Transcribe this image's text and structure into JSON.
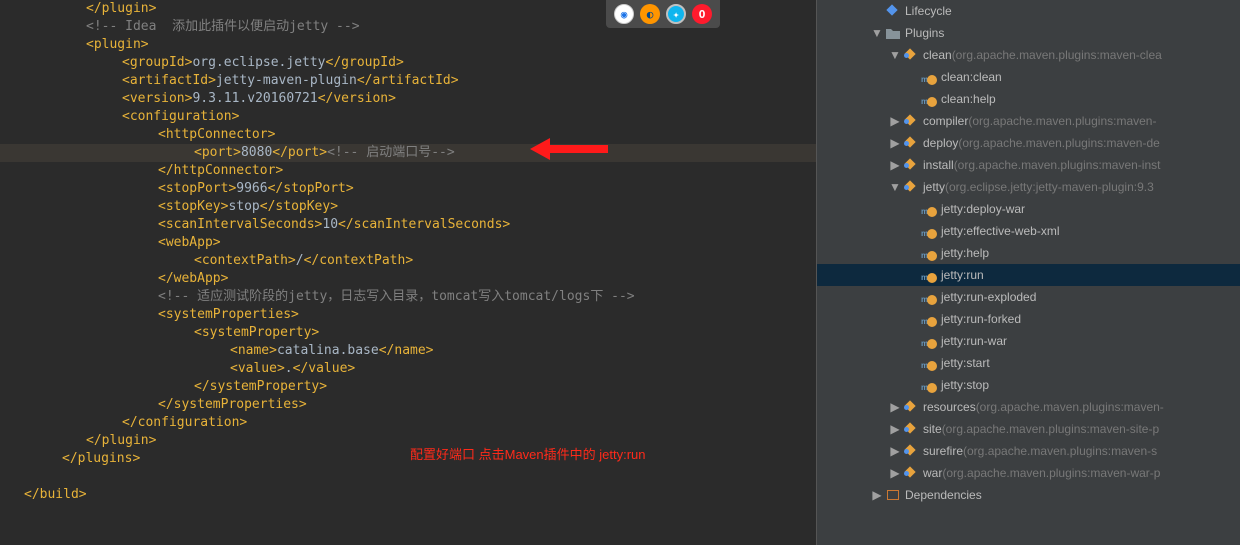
{
  "editor": {
    "lines": [
      {
        "indent": 86,
        "tokens": [
          {
            "c": "tag",
            "t": "</plugin>"
          }
        ]
      },
      {
        "indent": 86,
        "tokens": [
          {
            "c": "comment",
            "t": "<!-- Idea  添加此插件以便启动jetty -->"
          }
        ]
      },
      {
        "indent": 86,
        "tokens": [
          {
            "c": "tag",
            "t": "<plugin>"
          }
        ]
      },
      {
        "indent": 122,
        "tokens": [
          {
            "c": "tag",
            "t": "<groupId>"
          },
          {
            "c": "txtval",
            "t": "org.eclipse.jetty"
          },
          {
            "c": "tag",
            "t": "</groupId>"
          }
        ]
      },
      {
        "indent": 122,
        "tokens": [
          {
            "c": "tag",
            "t": "<artifactId>"
          },
          {
            "c": "txtval",
            "t": "jetty-maven-plugin"
          },
          {
            "c": "tag",
            "t": "</artifactId>"
          }
        ]
      },
      {
        "indent": 122,
        "tokens": [
          {
            "c": "tag",
            "t": "<version>"
          },
          {
            "c": "txtval",
            "t": "9.3.11.v20160721"
          },
          {
            "c": "tag",
            "t": "</version>"
          }
        ]
      },
      {
        "indent": 122,
        "tokens": [
          {
            "c": "tag",
            "t": "<configuration>"
          }
        ]
      },
      {
        "indent": 158,
        "tokens": [
          {
            "c": "tag",
            "t": "<httpConnector>"
          }
        ]
      },
      {
        "indent": 194,
        "hl": true,
        "tokens": [
          {
            "c": "tag",
            "t": "<port>"
          },
          {
            "c": "txtval",
            "t": "8080"
          },
          {
            "c": "tag",
            "t": "</port>"
          },
          {
            "c": "comment",
            "t": "<!-- 启动端口号-->"
          }
        ]
      },
      {
        "indent": 158,
        "tokens": [
          {
            "c": "tag",
            "t": "</httpConnector>"
          }
        ]
      },
      {
        "indent": 158,
        "tokens": [
          {
            "c": "tag",
            "t": "<stopPort>"
          },
          {
            "c": "txtval",
            "t": "9966"
          },
          {
            "c": "tag",
            "t": "</stopPort>"
          }
        ]
      },
      {
        "indent": 158,
        "tokens": [
          {
            "c": "tag",
            "t": "<stopKey>"
          },
          {
            "c": "txtval",
            "t": "stop"
          },
          {
            "c": "tag",
            "t": "</stopKey>"
          }
        ]
      },
      {
        "indent": 158,
        "tokens": [
          {
            "c": "tag",
            "t": "<scanIntervalSeconds>"
          },
          {
            "c": "txtval",
            "t": "10"
          },
          {
            "c": "tag",
            "t": "</scanIntervalSeconds>"
          }
        ]
      },
      {
        "indent": 158,
        "tokens": [
          {
            "c": "tag",
            "t": "<webApp>"
          }
        ]
      },
      {
        "indent": 194,
        "tokens": [
          {
            "c": "tag",
            "t": "<contextPath>"
          },
          {
            "c": "txtval",
            "t": "/"
          },
          {
            "c": "tag",
            "t": "</contextPath>"
          }
        ]
      },
      {
        "indent": 158,
        "tokens": [
          {
            "c": "tag",
            "t": "</webApp>"
          }
        ]
      },
      {
        "indent": 158,
        "tokens": [
          {
            "c": "comment",
            "t": "<!-- 适应测试阶段的jetty，日志写入目录，tomcat写入tomcat/logs下 -->"
          }
        ]
      },
      {
        "indent": 158,
        "tokens": [
          {
            "c": "tag",
            "t": "<systemProperties>"
          }
        ]
      },
      {
        "indent": 194,
        "tokens": [
          {
            "c": "tag",
            "t": "<systemProperty>"
          }
        ]
      },
      {
        "indent": 230,
        "tokens": [
          {
            "c": "tag",
            "t": "<name>"
          },
          {
            "c": "txtval",
            "t": "catalina.base"
          },
          {
            "c": "tag",
            "t": "</name>"
          }
        ]
      },
      {
        "indent": 230,
        "tokens": [
          {
            "c": "tag",
            "t": "<value>"
          },
          {
            "c": "txtval",
            "t": "."
          },
          {
            "c": "tag",
            "t": "</value>"
          }
        ]
      },
      {
        "indent": 194,
        "tokens": [
          {
            "c": "tag",
            "t": "</systemProperty>"
          }
        ]
      },
      {
        "indent": 158,
        "tokens": [
          {
            "c": "tag",
            "t": "</systemProperties>"
          }
        ]
      },
      {
        "indent": 122,
        "tokens": [
          {
            "c": "tag",
            "t": "</configuration>"
          }
        ]
      },
      {
        "indent": 86,
        "tokens": [
          {
            "c": "tag",
            "t": "</plugin>"
          }
        ]
      },
      {
        "indent": 62,
        "tokens": [
          {
            "c": "tag",
            "t": "</plugins>"
          }
        ]
      },
      {
        "indent": 62,
        "tokens": []
      },
      {
        "indent": 24,
        "tokens": [
          {
            "c": "tag",
            "t": "</build>"
          }
        ]
      },
      {
        "indent": 24,
        "tokens": []
      }
    ],
    "annotation_text": "配置好端口 点击Maven插件中的 jetty:run",
    "browsers": [
      "chrome",
      "firefox",
      "safari",
      "opera"
    ]
  },
  "tree": {
    "items": [
      {
        "depth": 3,
        "twisty": "",
        "icon": "life",
        "label": "Lifecycle",
        "dim": ""
      },
      {
        "depth": 3,
        "twisty": "▼",
        "icon": "plugins",
        "label": "Plugins",
        "dim": ""
      },
      {
        "depth": 4,
        "twisty": "▼",
        "icon": "plugin",
        "label": "clean",
        "dim": " (org.apache.maven.plugins:maven-clea"
      },
      {
        "depth": 5,
        "twisty": "",
        "icon": "goal",
        "label": "clean:clean",
        "dim": ""
      },
      {
        "depth": 5,
        "twisty": "",
        "icon": "goal",
        "label": "clean:help",
        "dim": ""
      },
      {
        "depth": 4,
        "twisty": "▶",
        "icon": "plugin",
        "label": "compiler",
        "dim": " (org.apache.maven.plugins:maven-"
      },
      {
        "depth": 4,
        "twisty": "▶",
        "icon": "plugin",
        "label": "deploy",
        "dim": " (org.apache.maven.plugins:maven-de"
      },
      {
        "depth": 4,
        "twisty": "▶",
        "icon": "plugin",
        "label": "install",
        "dim": " (org.apache.maven.plugins:maven-inst"
      },
      {
        "depth": 4,
        "twisty": "▼",
        "icon": "plugin",
        "label": "jetty",
        "dim": " (org.eclipse.jetty:jetty-maven-plugin:9.3"
      },
      {
        "depth": 5,
        "twisty": "",
        "icon": "goal",
        "label": "jetty:deploy-war",
        "dim": ""
      },
      {
        "depth": 5,
        "twisty": "",
        "icon": "goal",
        "label": "jetty:effective-web-xml",
        "dim": ""
      },
      {
        "depth": 5,
        "twisty": "",
        "icon": "goal",
        "label": "jetty:help",
        "dim": ""
      },
      {
        "depth": 5,
        "twisty": "",
        "icon": "goal",
        "label": "jetty:run",
        "dim": "",
        "selected": true
      },
      {
        "depth": 5,
        "twisty": "",
        "icon": "goal",
        "label": "jetty:run-exploded",
        "dim": ""
      },
      {
        "depth": 5,
        "twisty": "",
        "icon": "goal",
        "label": "jetty:run-forked",
        "dim": ""
      },
      {
        "depth": 5,
        "twisty": "",
        "icon": "goal",
        "label": "jetty:run-war",
        "dim": ""
      },
      {
        "depth": 5,
        "twisty": "",
        "icon": "goal",
        "label": "jetty:start",
        "dim": ""
      },
      {
        "depth": 5,
        "twisty": "",
        "icon": "goal",
        "label": "jetty:stop",
        "dim": ""
      },
      {
        "depth": 4,
        "twisty": "▶",
        "icon": "plugin",
        "label": "resources",
        "dim": " (org.apache.maven.plugins:maven-"
      },
      {
        "depth": 4,
        "twisty": "▶",
        "icon": "plugin",
        "label": "site",
        "dim": " (org.apache.maven.plugins:maven-site-p"
      },
      {
        "depth": 4,
        "twisty": "▶",
        "icon": "plugin",
        "label": "surefire",
        "dim": " (org.apache.maven.plugins:maven-s"
      },
      {
        "depth": 4,
        "twisty": "▶",
        "icon": "plugin",
        "label": "war",
        "dim": " (org.apache.maven.plugins:maven-war-p"
      },
      {
        "depth": 3,
        "twisty": "▶",
        "icon": "dep",
        "label": "Dependencies",
        "dim": ""
      }
    ]
  }
}
